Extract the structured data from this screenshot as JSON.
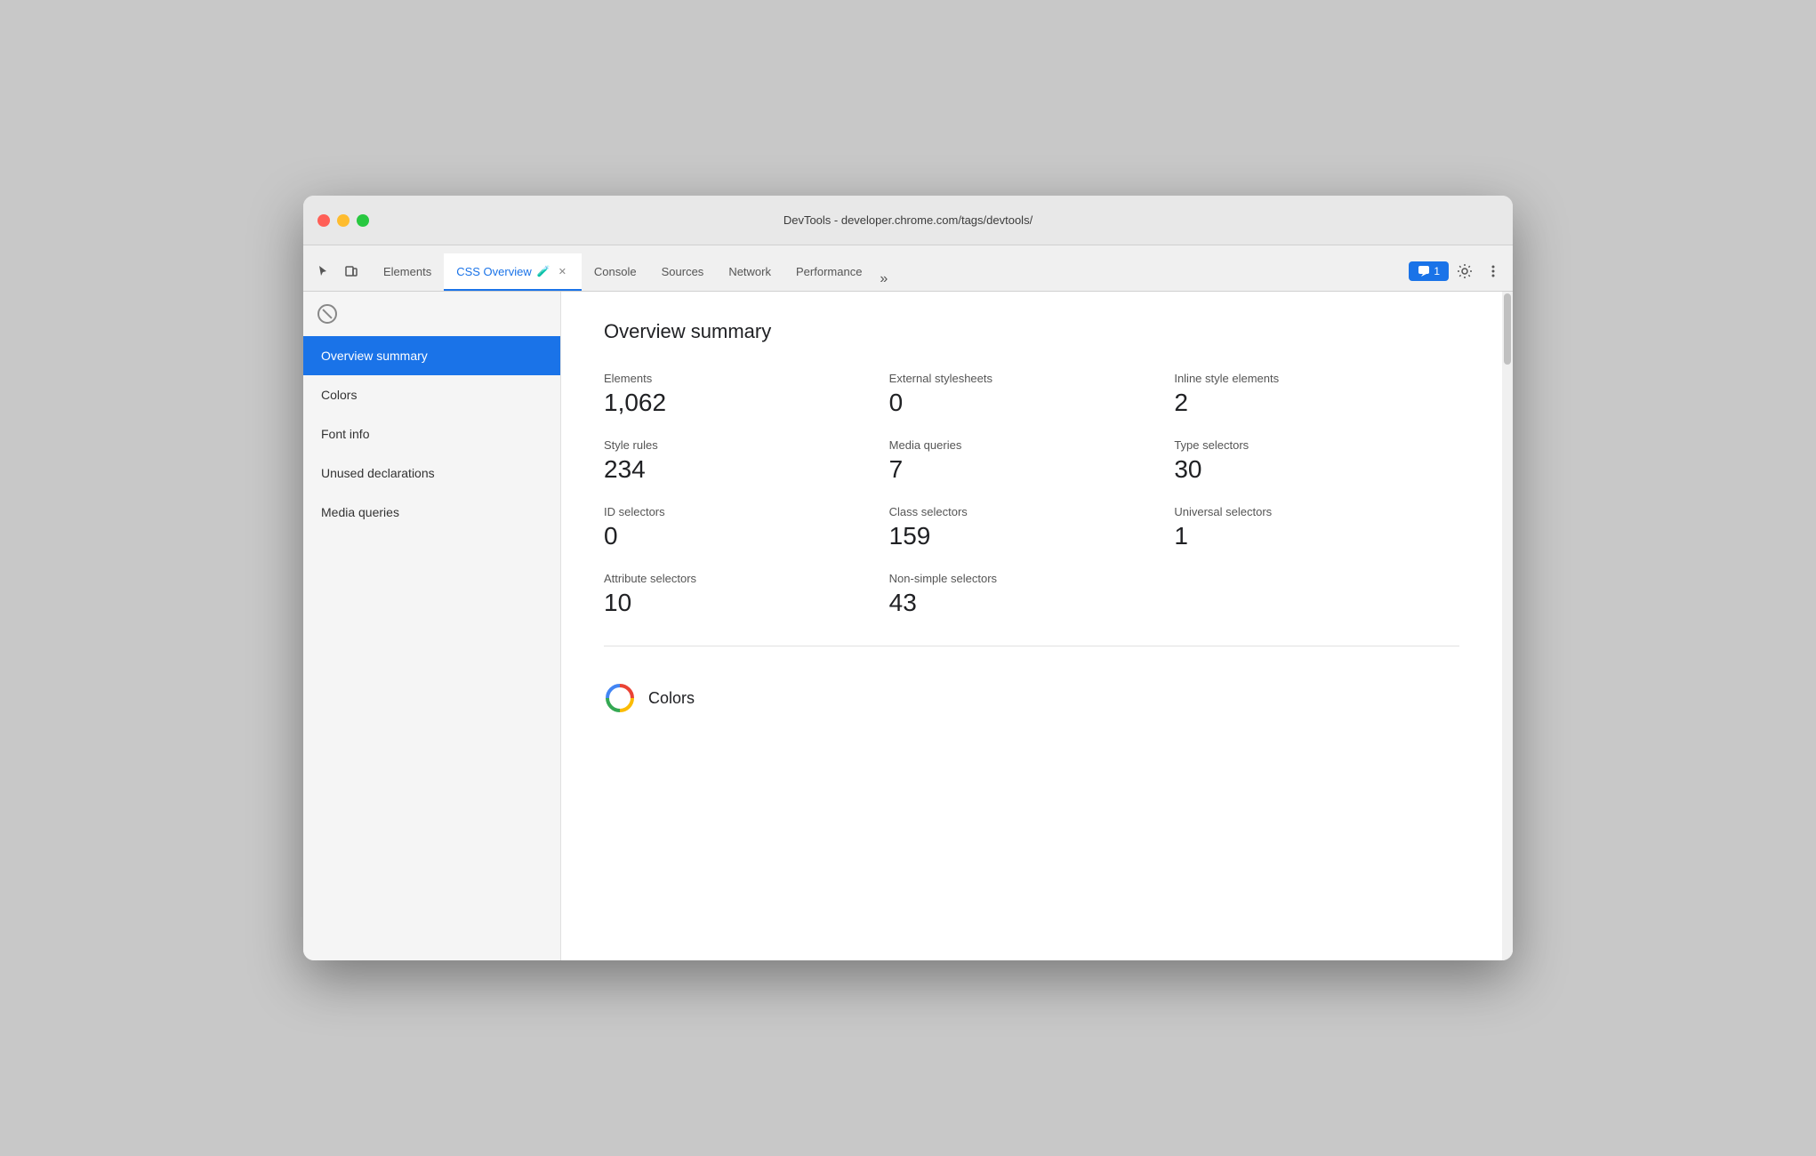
{
  "window": {
    "title": "DevTools - developer.chrome.com/tags/devtools/"
  },
  "tabs": {
    "items": [
      {
        "id": "elements",
        "label": "Elements",
        "active": false,
        "closable": false
      },
      {
        "id": "css-overview",
        "label": "CSS Overview",
        "active": true,
        "closable": true,
        "has_icon": true
      },
      {
        "id": "console",
        "label": "Console",
        "active": false,
        "closable": false
      },
      {
        "id": "sources",
        "label": "Sources",
        "active": false,
        "closable": false
      },
      {
        "id": "network",
        "label": "Network",
        "active": false,
        "closable": false
      },
      {
        "id": "performance",
        "label": "Performance",
        "active": false,
        "closable": false
      }
    ],
    "more_label": "»",
    "chat_count": "1"
  },
  "sidebar": {
    "items": [
      {
        "id": "overview-summary",
        "label": "Overview summary",
        "active": true
      },
      {
        "id": "colors",
        "label": "Colors",
        "active": false
      },
      {
        "id": "font-info",
        "label": "Font info",
        "active": false
      },
      {
        "id": "unused-declarations",
        "label": "Unused declarations",
        "active": false
      },
      {
        "id": "media-queries",
        "label": "Media queries",
        "active": false
      }
    ]
  },
  "main": {
    "page_title": "Overview summary",
    "stats": [
      {
        "id": "elements",
        "label": "Elements",
        "value": "1,062"
      },
      {
        "id": "external-stylesheets",
        "label": "External stylesheets",
        "value": "0"
      },
      {
        "id": "inline-style-elements",
        "label": "Inline style elements",
        "value": "2"
      },
      {
        "id": "style-rules",
        "label": "Style rules",
        "value": "234"
      },
      {
        "id": "media-queries",
        "label": "Media queries",
        "value": "7"
      },
      {
        "id": "type-selectors",
        "label": "Type selectors",
        "value": "30"
      },
      {
        "id": "id-selectors",
        "label": "ID selectors",
        "value": "0"
      },
      {
        "id": "class-selectors",
        "label": "Class selectors",
        "value": "159"
      },
      {
        "id": "universal-selectors",
        "label": "Universal selectors",
        "value": "1"
      },
      {
        "id": "attribute-selectors",
        "label": "Attribute selectors",
        "value": "10"
      },
      {
        "id": "non-simple-selectors",
        "label": "Non-simple selectors",
        "value": "43"
      }
    ],
    "colors_section_label": "Colors"
  },
  "colors": {
    "accent": "#1a73e8"
  }
}
